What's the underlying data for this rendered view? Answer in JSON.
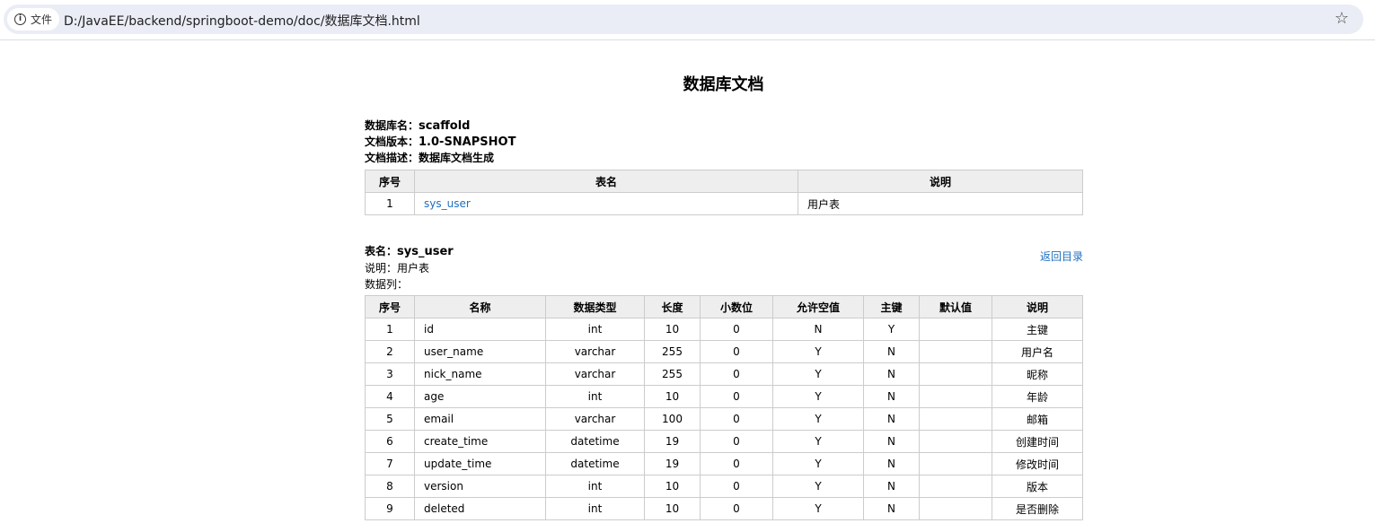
{
  "browser": {
    "security_label": "文件",
    "url": "D:/JavaEE/backend/springboot-demo/doc/数据库文档.html"
  },
  "title": "数据库文档",
  "meta": {
    "db_label": "数据库名：",
    "db_value": "scaffold",
    "ver_label": "文档版本：",
    "ver_value": "1.0-SNAPSHOT",
    "desc_label": "文档描述：",
    "desc_value": "数据库文档生成"
  },
  "index_table": {
    "headers": [
      "序号",
      "表名",
      "说明"
    ],
    "rows": [
      [
        "1",
        "sys_user",
        "用户表"
      ]
    ]
  },
  "detail": {
    "name_label": "表名：",
    "name_value": "sys_user",
    "desc": "说明：用户表",
    "cols_label": "数据列：",
    "back_link": "返回目录"
  },
  "columns_table": {
    "headers": [
      "序号",
      "名称",
      "数据类型",
      "长度",
      "小数位",
      "允许空值",
      "主键",
      "默认值",
      "说明"
    ],
    "rows": [
      [
        "1",
        "id",
        "int",
        "10",
        "0",
        "N",
        "Y",
        "",
        "主键"
      ],
      [
        "2",
        "user_name",
        "varchar",
        "255",
        "0",
        "Y",
        "N",
        "",
        "用户名"
      ],
      [
        "3",
        "nick_name",
        "varchar",
        "255",
        "0",
        "Y",
        "N",
        "",
        "昵称"
      ],
      [
        "4",
        "age",
        "int",
        "10",
        "0",
        "Y",
        "N",
        "",
        "年龄"
      ],
      [
        "5",
        "email",
        "varchar",
        "100",
        "0",
        "Y",
        "N",
        "",
        "邮箱"
      ],
      [
        "6",
        "create_time",
        "datetime",
        "19",
        "0",
        "Y",
        "N",
        "",
        "创建时间"
      ],
      [
        "7",
        "update_time",
        "datetime",
        "19",
        "0",
        "Y",
        "N",
        "",
        "修改时间"
      ],
      [
        "8",
        "version",
        "int",
        "10",
        "0",
        "Y",
        "N",
        "",
        "版本"
      ],
      [
        "9",
        "deleted",
        "int",
        "10",
        "0",
        "Y",
        "N",
        "",
        "是否删除"
      ]
    ]
  }
}
